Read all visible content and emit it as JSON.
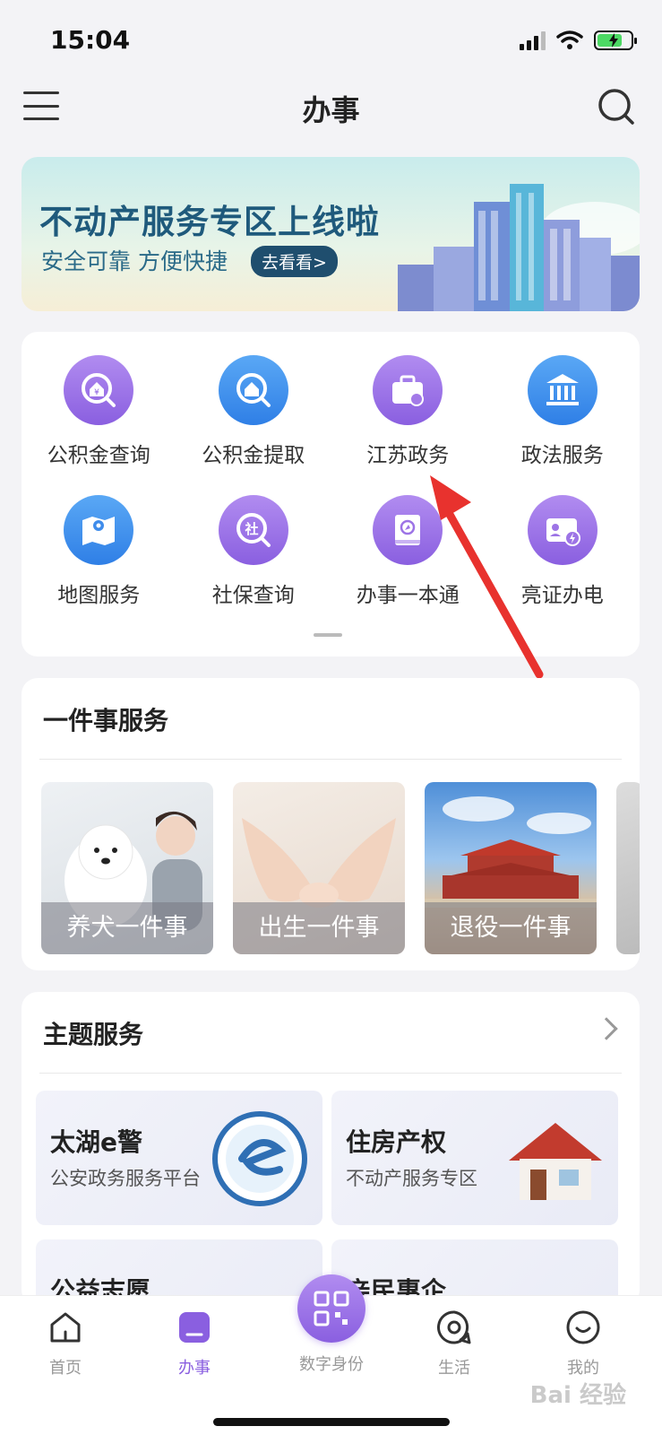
{
  "status_bar": {
    "time": "15:04",
    "battery_level": 0.75,
    "battery_color": "#4cd964"
  },
  "header": {
    "title": "办事",
    "menu_icon": "hamburger-menu-icon",
    "search_icon": "search-icon"
  },
  "banner": {
    "title": "不动产服务专区上线啦",
    "subtitle": "安全可靠 方便快捷",
    "button_label": "去看看>"
  },
  "services": {
    "items": [
      {
        "label": "公积金查询",
        "icon": "fund-query-icon",
        "color": "purple"
      },
      {
        "label": "公积金提取",
        "icon": "fund-withdraw-icon",
        "color": "blue"
      },
      {
        "label": "江苏政务",
        "icon": "briefcase-icon",
        "color": "purple"
      },
      {
        "label": "政法服务",
        "icon": "courthouse-icon",
        "color": "blue"
      },
      {
        "label": "地图服务",
        "icon": "map-icon",
        "color": "blue"
      },
      {
        "label": "社保查询",
        "icon": "social-security-icon",
        "color": "purple"
      },
      {
        "label": "办事一本通",
        "icon": "book-icon",
        "color": "purple"
      },
      {
        "label": "亮证办电",
        "icon": "id-card-icon",
        "color": "purple"
      }
    ]
  },
  "one_thing": {
    "title": "一件事服务",
    "items": [
      {
        "label": "养犬一件事"
      },
      {
        "label": "出生一件事"
      },
      {
        "label": "退役一件事"
      }
    ]
  },
  "theme": {
    "title": "主题服务",
    "tiles": [
      {
        "title": "太湖e警",
        "subtitle": "公安政务服务平台"
      },
      {
        "title": "住房产权",
        "subtitle": "不动产服务专区"
      },
      {
        "title": "公益志愿",
        "subtitle": ""
      },
      {
        "title": "亲民惠企",
        "subtitle": ""
      }
    ]
  },
  "tabbar": {
    "tabs": [
      {
        "label": "首页"
      },
      {
        "label": "办事"
      },
      {
        "label": "数字身份"
      },
      {
        "label": "生活"
      },
      {
        "label": "我的"
      }
    ],
    "active_color": "#8a5fe0"
  },
  "watermark": "Bai 经验"
}
